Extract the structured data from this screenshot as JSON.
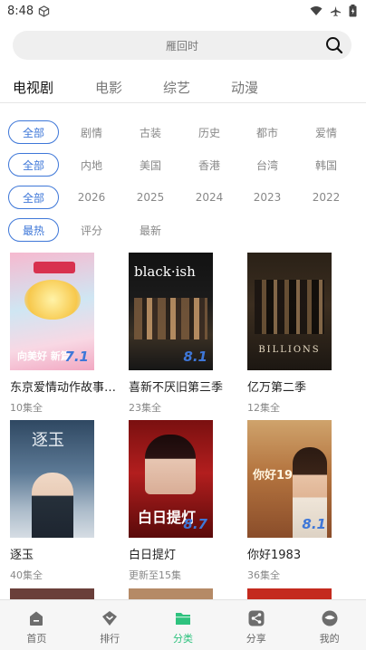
{
  "status": {
    "time": "8:48"
  },
  "search": {
    "placeholder": "雁回时"
  },
  "tabs": [
    "电视剧",
    "电影",
    "综艺",
    "动漫"
  ],
  "filters": [
    [
      "全部",
      "剧情",
      "古装",
      "历史",
      "都市",
      "爱情"
    ],
    [
      "全部",
      "内地",
      "美国",
      "香港",
      "台湾",
      "韩国"
    ],
    [
      "全部",
      "2026",
      "2025",
      "2024",
      "2023",
      "2022"
    ],
    [
      "最热",
      "评分",
      "最新"
    ]
  ],
  "cards": [
    {
      "title": "东京爱情动作故事東...",
      "sub": "10集全",
      "score": "7.1",
      "poster_text": "向美好 新篇"
    },
    {
      "title": "喜新不厌旧第三季",
      "sub": "23集全",
      "score": "8.1",
      "poster_text": "black·ish"
    },
    {
      "title": "亿万第二季",
      "sub": "12集全",
      "score": "",
      "poster_text": "BILLIONS"
    },
    {
      "title": "逐玉",
      "sub": "40集全",
      "score": "",
      "poster_text": "逐玉"
    },
    {
      "title": "白日提灯",
      "sub": "更新至15集",
      "score": "8.7",
      "poster_text": "白日提灯"
    },
    {
      "title": "你好1983",
      "sub": "36集全",
      "score": "8.1",
      "poster_text": "你好1983"
    }
  ],
  "nav": [
    {
      "label": "首页",
      "icon": "home-icon"
    },
    {
      "label": "排行",
      "icon": "ranking-icon"
    },
    {
      "label": "分类",
      "icon": "folder-icon"
    },
    {
      "label": "分享",
      "icon": "share-icon"
    },
    {
      "label": "我的",
      "icon": "profile-icon"
    }
  ],
  "colors": {
    "accent": "#3e77d8",
    "nav_active": "#2ec27e"
  }
}
